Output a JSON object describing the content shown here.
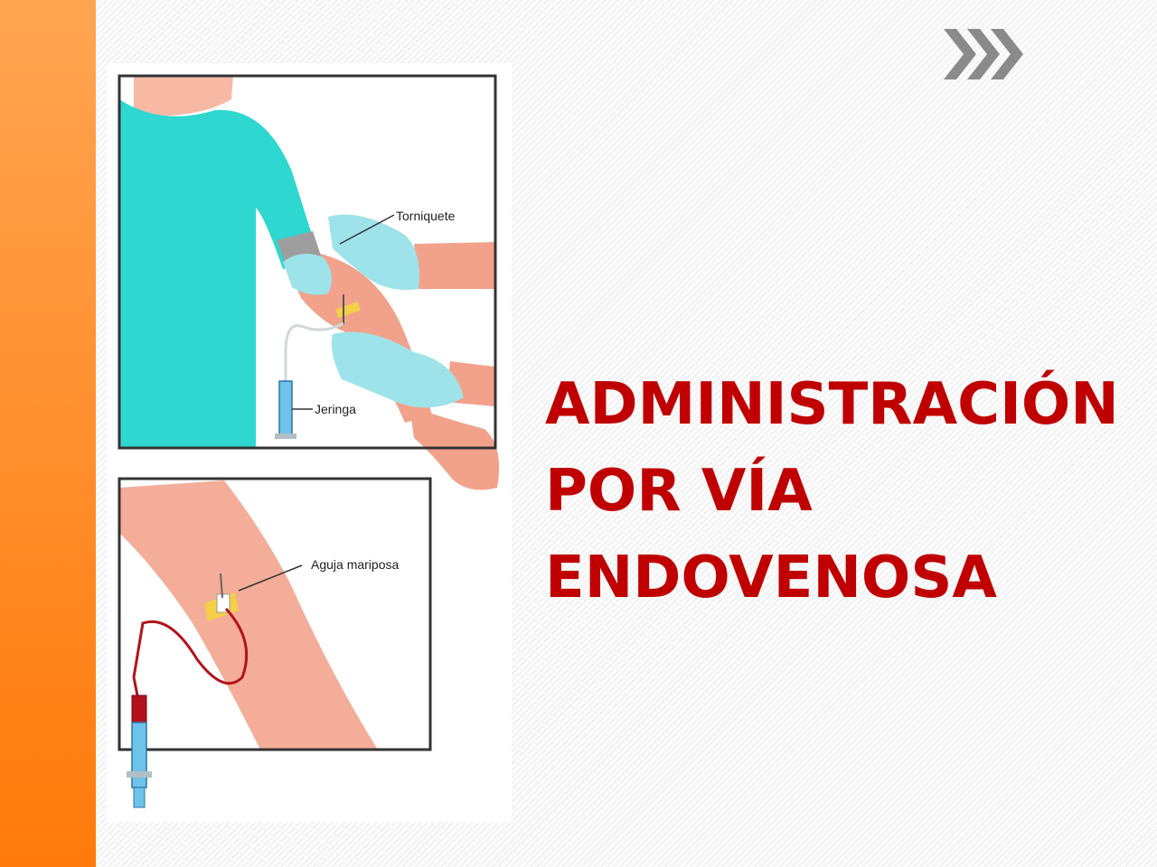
{
  "slide": {
    "title_lines": [
      "ADMINISTRACIÓN",
      "POR VÍA",
      "ENDOVENOSA"
    ],
    "accent_color": "#c00000",
    "sidebar_color": "#ff8d2a",
    "nav_icon": "triple-chevron-right-icon"
  },
  "illustration": {
    "top_panel": {
      "labels": {
        "tourniquet": "Torniquete",
        "syringe": "Jeringa"
      }
    },
    "bottom_panel": {
      "labels": {
        "butterfly_needle": "Aguja mariposa"
      }
    }
  }
}
